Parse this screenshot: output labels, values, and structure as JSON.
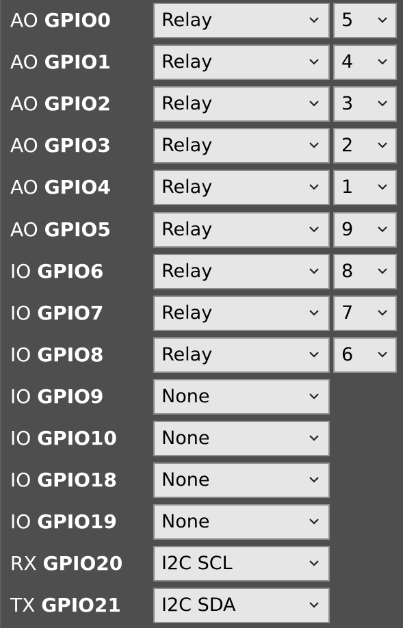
{
  "pins": [
    {
      "prefix": "AO",
      "gpio": "GPIO0",
      "role": "Relay",
      "channel": "5"
    },
    {
      "prefix": "AO",
      "gpio": "GPIO1",
      "role": "Relay",
      "channel": "4"
    },
    {
      "prefix": "AO",
      "gpio": "GPIO2",
      "role": "Relay",
      "channel": "3"
    },
    {
      "prefix": "AO",
      "gpio": "GPIO3",
      "role": "Relay",
      "channel": "2"
    },
    {
      "prefix": "AO",
      "gpio": "GPIO4",
      "role": "Relay",
      "channel": "1"
    },
    {
      "prefix": "AO",
      "gpio": "GPIO5",
      "role": "Relay",
      "channel": "9"
    },
    {
      "prefix": "IO",
      "gpio": "GPIO6",
      "role": "Relay",
      "channel": "8"
    },
    {
      "prefix": "IO",
      "gpio": "GPIO7",
      "role": "Relay",
      "channel": "7"
    },
    {
      "prefix": "IO",
      "gpio": "GPIO8",
      "role": "Relay",
      "channel": "6"
    },
    {
      "prefix": "IO",
      "gpio": "GPIO9",
      "role": "None"
    },
    {
      "prefix": "IO",
      "gpio": "GPIO10",
      "role": "None"
    },
    {
      "prefix": "IO",
      "gpio": "GPIO18",
      "role": "None"
    },
    {
      "prefix": "IO",
      "gpio": "GPIO19",
      "role": "None"
    },
    {
      "prefix": "RX",
      "gpio": "GPIO20",
      "role": "I2C SCL"
    },
    {
      "prefix": "TX",
      "gpio": "GPIO21",
      "role": "I2C SDA"
    }
  ],
  "icons": {
    "dropdown": "chevron-down-icon"
  },
  "colors": {
    "panel_background": "#4e4e4e",
    "select_background": "#e6e6e6",
    "select_border": "#8f8f8f",
    "label_text": "#ffffff"
  }
}
